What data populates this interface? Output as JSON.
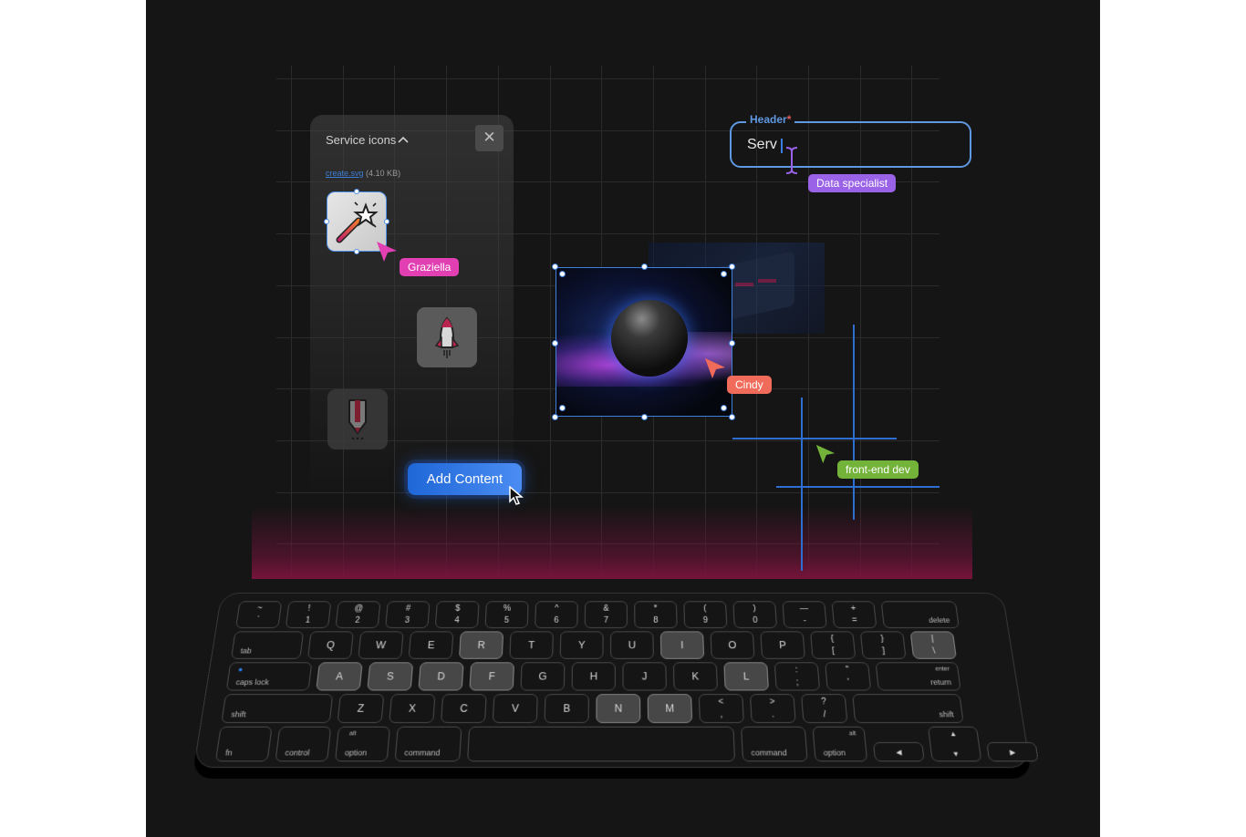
{
  "panel": {
    "title": "Service icons",
    "chevron_icon": "chevron-up-icon",
    "close_icon": "close-icon",
    "close_glyph": "✕",
    "chevron_glyph": "⌃",
    "file_name": "create.svg",
    "file_size": "(4.10 KB)",
    "icons": [
      {
        "name": "magic-wand-icon",
        "selected": true
      },
      {
        "name": "rocket-icon",
        "selected": false
      },
      {
        "name": "pencil-icon",
        "selected": false
      }
    ]
  },
  "collaborators": [
    {
      "name": "Graziella",
      "color": "#e23fb2"
    },
    {
      "name": "Cindy",
      "color": "#f06b5a"
    },
    {
      "name": "Data specialist",
      "color": "#9a62e6"
    },
    {
      "name": "front-end dev",
      "color": "#73b33a"
    }
  ],
  "add_button": {
    "label": "Add Content"
  },
  "header_field": {
    "label": "Header",
    "required_mark": "*",
    "value": "Serv"
  },
  "colors": {
    "accent_blue": "#3f80dc",
    "background": "#151515",
    "glow": "#8a1441"
  },
  "keyboard": {
    "highlighted": [
      "R",
      "I",
      "\\",
      "A",
      "S",
      "D",
      "F",
      "L",
      "N",
      "M"
    ],
    "row1": [
      {
        "top": "~",
        "bottom": "`"
      },
      {
        "top": "!",
        "bottom": "1"
      },
      {
        "top": "@",
        "bottom": "2"
      },
      {
        "top": "#",
        "bottom": "3"
      },
      {
        "top": "$",
        "bottom": "4"
      },
      {
        "top": "%",
        "bottom": "5"
      },
      {
        "top": "^",
        "bottom": "6"
      },
      {
        "top": "&",
        "bottom": "7"
      },
      {
        "top": "*",
        "bottom": "8"
      },
      {
        "top": "(",
        "bottom": "9"
      },
      {
        "top": ")",
        "bottom": "0"
      },
      {
        "top": "—",
        "bottom": "-"
      },
      {
        "top": "+",
        "bottom": "="
      },
      {
        "label": "delete"
      }
    ],
    "row2": {
      "tab": "tab",
      "letters": [
        "Q",
        "W",
        "E",
        "R",
        "T",
        "Y",
        "U",
        "I",
        "O",
        "P"
      ],
      "symbols": [
        {
          "top": "{",
          "bottom": "["
        },
        {
          "top": "}",
          "bottom": "]"
        },
        {
          "top": "|",
          "bottom": "\\"
        }
      ]
    },
    "row3": {
      "caps": "caps lock",
      "letters": [
        "A",
        "S",
        "D",
        "F",
        "G",
        "H",
        "J",
        "K",
        "L"
      ],
      "symbols": [
        {
          "top": ":",
          "bottom": ";"
        },
        {
          "top": "\"",
          "bottom": "'"
        }
      ],
      "enter_top": "enter",
      "enter_bottom": "return"
    },
    "row4": {
      "shift_left": "shift",
      "letters": [
        "Z",
        "X",
        "C",
        "V",
        "B",
        "N",
        "M"
      ],
      "symbols": [
        {
          "top": "<",
          "bottom": ","
        },
        {
          "top": ">",
          "bottom": "."
        },
        {
          "top": "?",
          "bottom": "/"
        }
      ],
      "shift_right": "shift"
    },
    "row5": {
      "fn": "fn",
      "control": "control",
      "alt": "alt",
      "option": "option",
      "command": "command",
      "arrows": {
        "left": "◀",
        "up": "▲",
        "down": "▼",
        "right": "▶"
      }
    }
  }
}
